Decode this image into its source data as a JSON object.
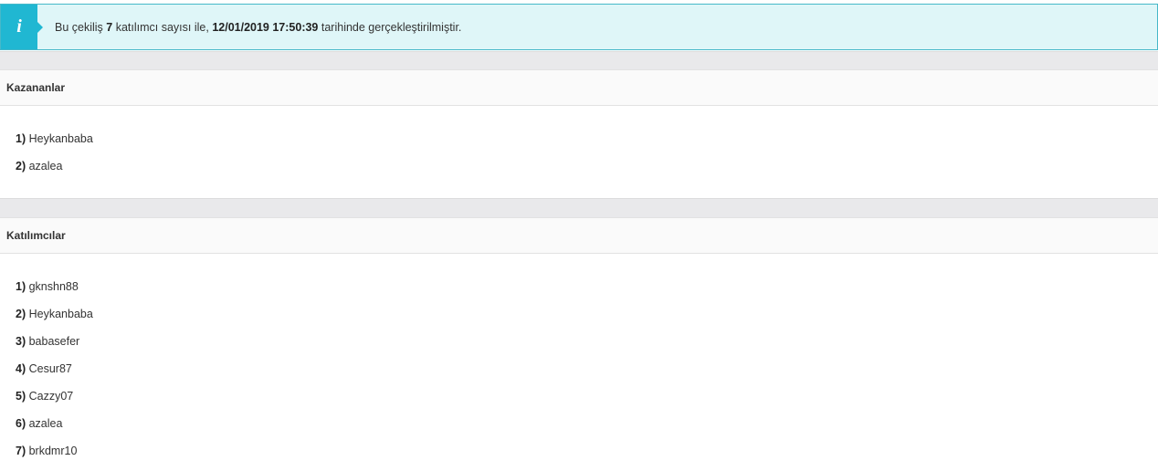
{
  "alert": {
    "icon": "info-icon",
    "icon_glyph": "i",
    "prefix": "Bu çekiliş",
    "count": "7",
    "middle": "katılımcı sayısı ile,",
    "datetime": "12/01/2019 17:50:39",
    "suffix": "tarihinde gerçekleştirilmiştir."
  },
  "winners": {
    "title": "Kazananlar",
    "items": [
      {
        "num": "1)",
        "name": "Heykanbaba"
      },
      {
        "num": "2)",
        "name": "azalea"
      }
    ]
  },
  "participants": {
    "title": "Katılımcılar",
    "items": [
      {
        "num": "1)",
        "name": "gknshn88"
      },
      {
        "num": "2)",
        "name": "Heykanbaba"
      },
      {
        "num": "3)",
        "name": "babasefer"
      },
      {
        "num": "4)",
        "name": "Cesur87"
      },
      {
        "num": "5)",
        "name": "Cazzy07"
      },
      {
        "num": "6)",
        "name": "azalea"
      },
      {
        "num": "7)",
        "name": "brkdmr10"
      }
    ]
  },
  "colors": {
    "alert_bg": "#dff6f8",
    "alert_border": "#46b8c9",
    "icon_bg": "#20b7d2",
    "section_gap": "#e9e9eb"
  }
}
